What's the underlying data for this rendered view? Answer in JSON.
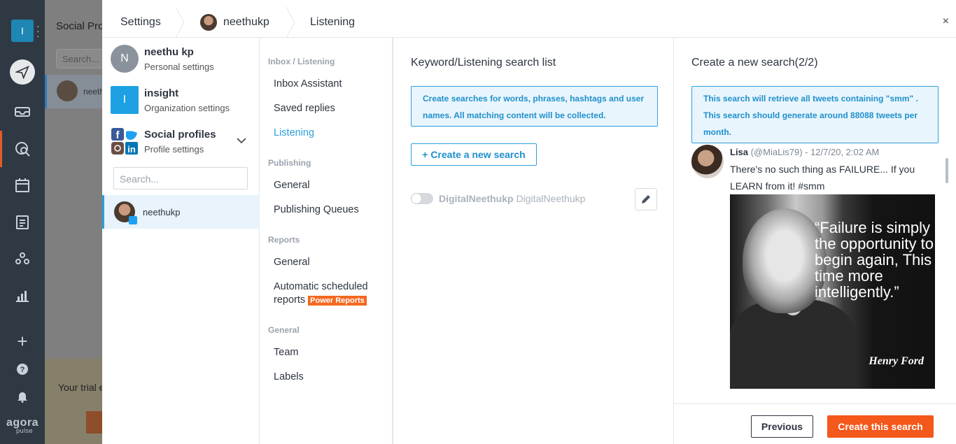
{
  "app": {
    "logo_letter": "I",
    "background_title": "Social Pro",
    "background_search_placeholder": "Search...",
    "background_profile_name": "neeth",
    "trial_text": "Your trial e",
    "brand": "agora",
    "brand_sub": "pulse"
  },
  "breadcrumb": {
    "settings": "Settings",
    "profile": "neethukp",
    "page": "Listening",
    "close": "×"
  },
  "accounts": [
    {
      "initial": "N",
      "name": "neethu kp",
      "sub": "Personal settings",
      "color": "#8a939c"
    },
    {
      "initial": "I",
      "name": "insight",
      "sub": "Organization settings",
      "color": "#1da1e2"
    },
    {
      "initial": "",
      "name": "Social profiles",
      "sub": "Profile settings"
    }
  ],
  "profile_search_placeholder": "Search...",
  "profile_item": "neethukp",
  "nav": {
    "inbox_header": "Inbox / Listening",
    "inbox_assistant": "Inbox Assistant",
    "saved_replies": "Saved replies",
    "listening": "Listening",
    "publishing_header": "Publishing",
    "publishing_general": "General",
    "publishing_queues": "Publishing Queues",
    "reports_header": "Reports",
    "reports_general": "General",
    "auto_reports_1": "Automatic scheduled",
    "auto_reports_2": "reports",
    "power_badge": "Power Reports",
    "general_header": "General",
    "team": "Team",
    "labels": "Labels"
  },
  "keyword": {
    "title": "Keyword/Listening search list",
    "info": "Create searches for words, phrases, hashtags and user names. All matching content will be collected.",
    "create_button": "+ Create a new search",
    "item_name": "DigitalNeethukp",
    "item_handle": "DigitalNeethukp",
    "item_enabled": false
  },
  "new_search": {
    "title": "Create a new search(2/2)",
    "info": "This search will retrieve all tweets containing \"smm\" . This search should generate around 88088 tweets per month.",
    "tweet": {
      "author": "Lisa",
      "handle_date": "(@MiaLis79) - 12/7/20, 2:02 AM",
      "text": "There's no such thing as FAILURE... If you LEARN from it! #smm",
      "quote": "“Failure is simply the opportunity to begin again, This time more intelligently.”",
      "quote_author": "Henry Ford"
    },
    "previous": "Previous",
    "create": "Create this search"
  },
  "colors": {
    "accent_blue": "#2d9fd9",
    "accent_orange": "#f4581b",
    "sidebar_dark": "#2f3944"
  }
}
